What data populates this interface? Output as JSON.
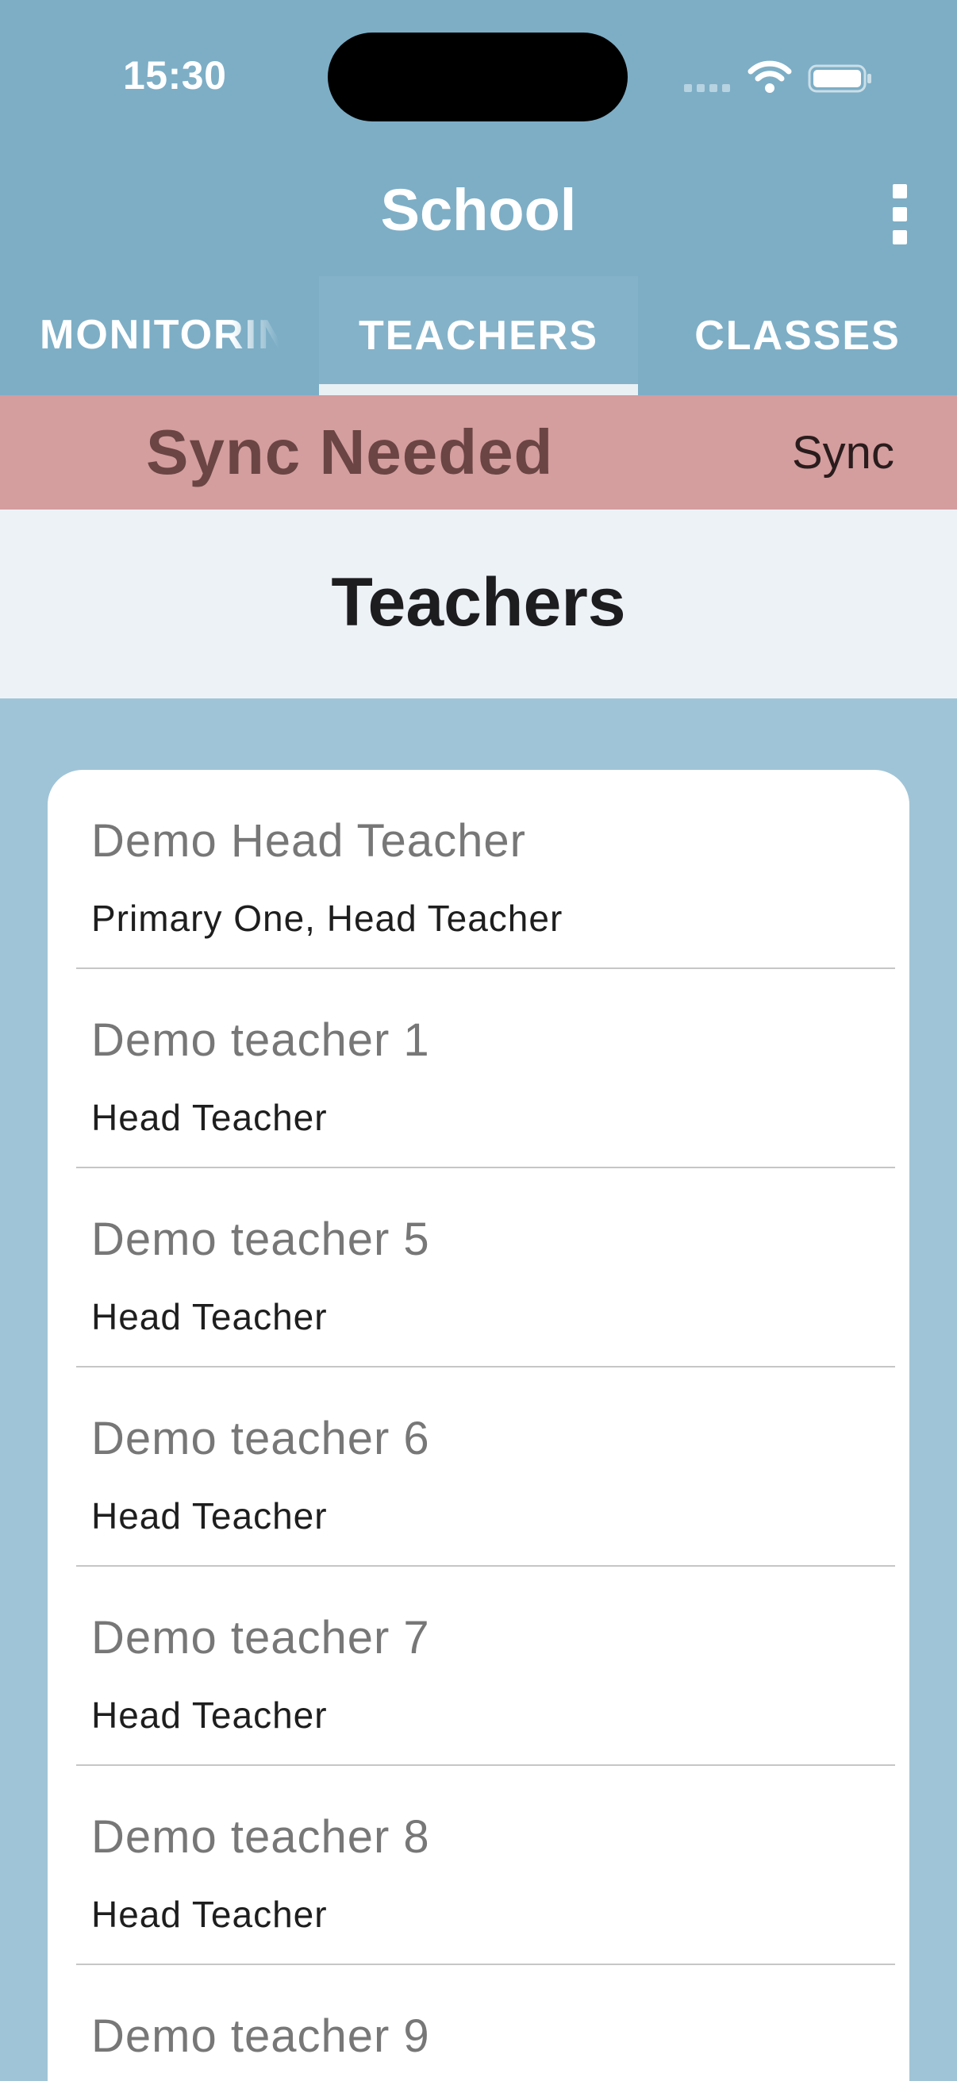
{
  "status_bar": {
    "time": "15:30",
    "icons": [
      "cellular-signal-icon",
      "wifi-icon",
      "battery-icon"
    ]
  },
  "app_bar": {
    "title": "School",
    "menu_icon": "more-vertical-icon"
  },
  "tabs": [
    {
      "label": "MONITORING",
      "selected": false
    },
    {
      "label": "TEACHERS",
      "selected": true
    },
    {
      "label": "CLASSES",
      "selected": false
    }
  ],
  "sync_banner": {
    "message": "Sync Needed",
    "action_label": "Sync"
  },
  "page": {
    "title": "Teachers"
  },
  "teachers": [
    {
      "name": "Demo Head Teacher",
      "role": "Primary One, Head Teacher"
    },
    {
      "name": "Demo teacher 1",
      "role": "Head Teacher"
    },
    {
      "name": "Demo teacher 5",
      "role": "Head Teacher"
    },
    {
      "name": "Demo teacher 6",
      "role": "Head Teacher"
    },
    {
      "name": "Demo teacher 7",
      "role": "Head Teacher"
    },
    {
      "name": "Demo teacher 8",
      "role": "Head Teacher"
    },
    {
      "name": "Demo teacher 9",
      "role": ""
    }
  ],
  "colors": {
    "header_bg": "#7daec6",
    "page_bg": "#a0c4d7",
    "banner_bg": "#d49d9e",
    "banner_text": "#6a4543",
    "heading_bg": "#edf2f7",
    "tab_indicator": "#e9f1f5"
  }
}
